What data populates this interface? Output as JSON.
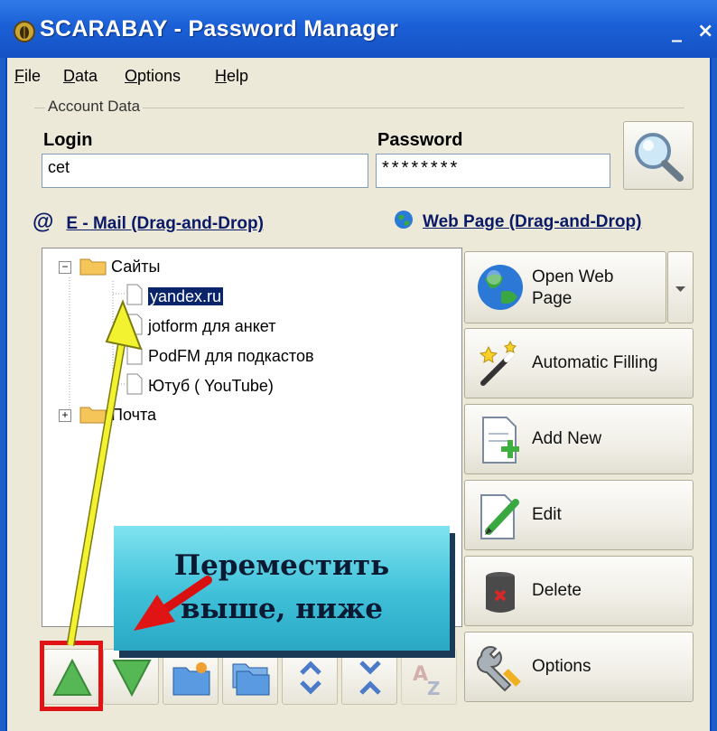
{
  "window": {
    "title": "SCARABAY - Password Manager",
    "minimize": "_",
    "close": "×"
  },
  "menu": [
    {
      "label": "File",
      "accel": "F",
      "rest": "ile"
    },
    {
      "label": "Data",
      "accel": "D",
      "rest": "ata"
    },
    {
      "label": "Options",
      "accel": "O",
      "rest": "ptions"
    },
    {
      "label": "Help",
      "accel": "H",
      "rest": "elp"
    }
  ],
  "account": {
    "group_label": "Account Data",
    "login_label": "Login",
    "login_value": "cet",
    "password_label": "Password",
    "password_value": "********"
  },
  "links": {
    "email_symbol": "@",
    "email_label": "E - Mail (Drag-and-Drop)",
    "web_label": "Web Page (Drag-and-Drop)"
  },
  "tree": {
    "folder1": "Сайты",
    "items": [
      "yandex.ru",
      "jotform для анкет",
      "PodFM для подкастов",
      "Ютуб ( YouTube)"
    ],
    "folder2": "Почта",
    "expanded": "⊟",
    "collapsed": "⊞"
  },
  "buttons": {
    "open_web_line1": "Open Web",
    "open_web_line2": "Page",
    "auto_fill": "Automatic Filling",
    "add_new": "Add New",
    "edit": "Edit",
    "delete": "Delete",
    "options": "Options"
  },
  "callout": {
    "line1": "Переместить",
    "line2": "выше, ниже"
  },
  "colors": {
    "accent": "#1b5fd6",
    "highlight": "#e01414",
    "callout": "#3fc0d8",
    "arrow_yellow": "#f0f020"
  }
}
